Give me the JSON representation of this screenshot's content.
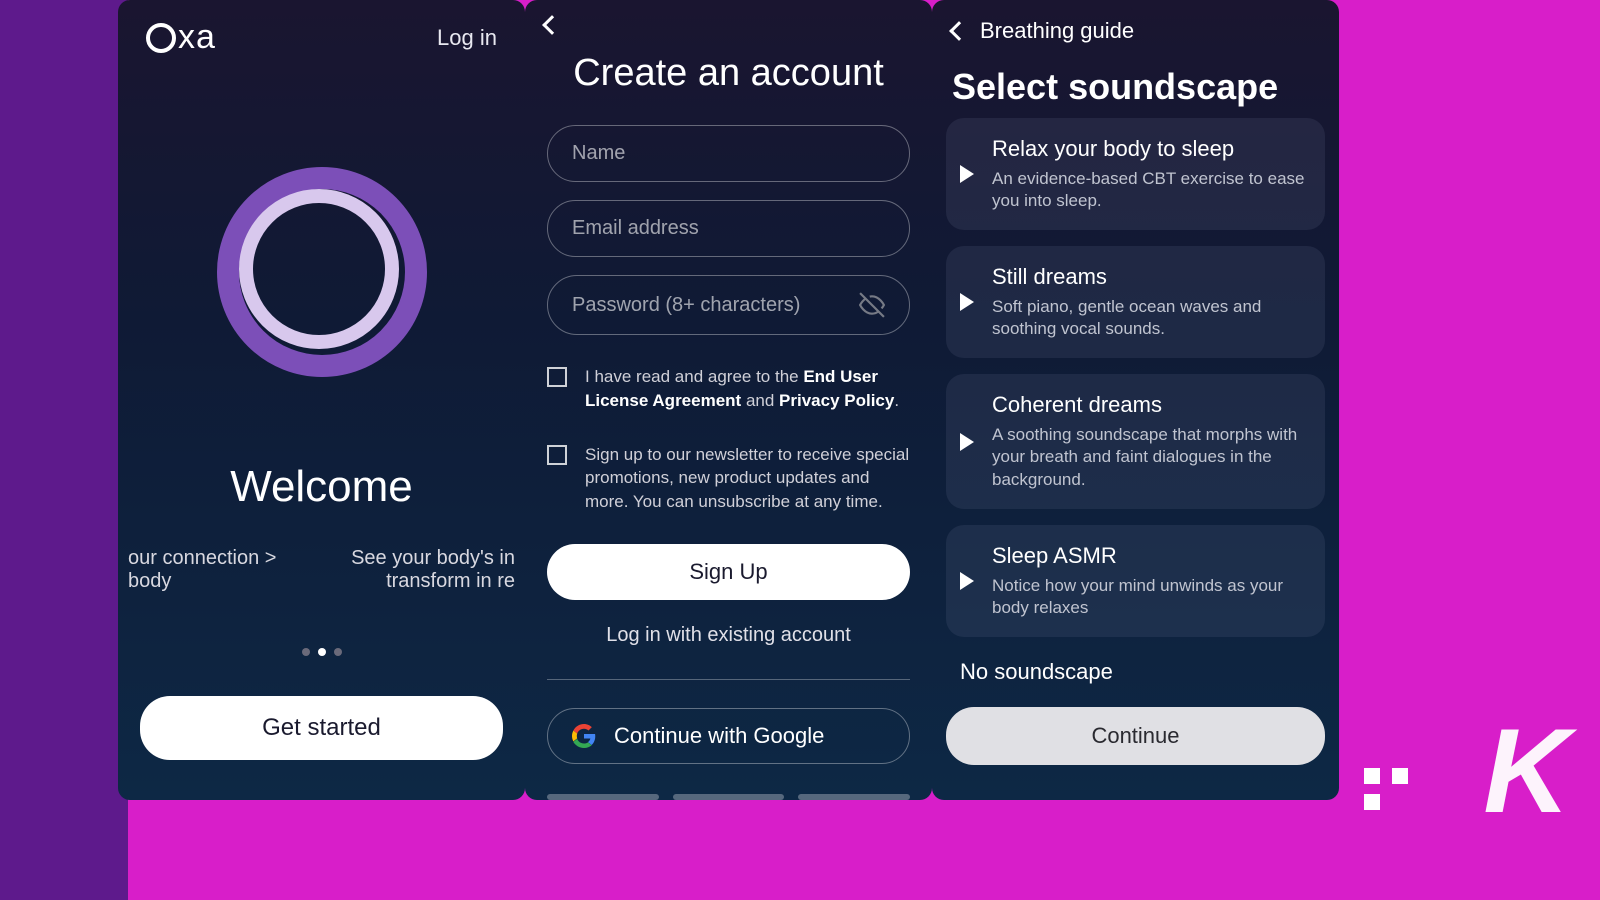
{
  "screen1": {
    "brand": "xa",
    "login_label": "Log in",
    "welcome_heading": "Welcome",
    "subtext_left": "our connection > body",
    "subtext_right": "See your body's in transform in re",
    "get_started_label": "Get started"
  },
  "screen2": {
    "title": "Create an account",
    "name_placeholder": "Name",
    "email_placeholder": "Email address",
    "password_placeholder": "Password (8+ characters)",
    "agree_prefix": "I have read and agree to the ",
    "eula_label": "End User License Agreement",
    "agree_and": " and ",
    "privacy_label": "Privacy Policy",
    "newsletter_text": "Sign up to our newsletter to receive special promotions, new product updates and more. You can unsubscribe at any time.",
    "signup_label": "Sign Up",
    "login_existing_label": "Log in with existing account",
    "google_label": "Continue with Google"
  },
  "screen3": {
    "back_label": "Breathing guide",
    "title": "Select soundscape",
    "items": [
      {
        "title": "Relax your body to sleep",
        "desc": "An evidence-based CBT exercise to ease you into sleep."
      },
      {
        "title": "Still dreams",
        "desc": "Soft piano, gentle ocean waves and soothing vocal sounds."
      },
      {
        "title": "Coherent dreams",
        "desc": "A soothing soundscape that morphs with your breath and faint dialogues in the background."
      },
      {
        "title": "Sleep ASMR",
        "desc": "Notice how your mind unwinds as your body relaxes"
      }
    ],
    "no_soundscape_label": "No soundscape",
    "continue_label": "Continue"
  }
}
